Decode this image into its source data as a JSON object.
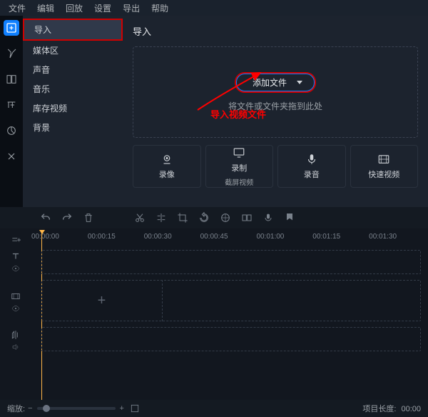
{
  "menu": [
    "文件",
    "编辑",
    "回放",
    "设置",
    "导出",
    "帮助"
  ],
  "sidebar": {
    "items": [
      "导入",
      "媒体区",
      "声音",
      "音乐",
      "库存视频",
      "背景"
    ],
    "selected_index": 0
  },
  "content": {
    "title": "导入",
    "add_button": "添加文件",
    "drop_hint": "将文件或文件夹拖到此处",
    "annotation": "导入视频文件"
  },
  "actions": [
    {
      "label": "录像",
      "sub": ""
    },
    {
      "label": "录制",
      "sub": "截屏视频"
    },
    {
      "label": "录音",
      "sub": ""
    },
    {
      "label": "快速视频",
      "sub": ""
    }
  ],
  "ruler": [
    "00:00:00",
    "00:00:15",
    "00:00:30",
    "00:00:45",
    "00:01:00",
    "00:01:15",
    "00:01:30"
  ],
  "footer": {
    "zoom_label": "缩放:",
    "length_label": "项目长度:",
    "length_value": "00:00"
  }
}
